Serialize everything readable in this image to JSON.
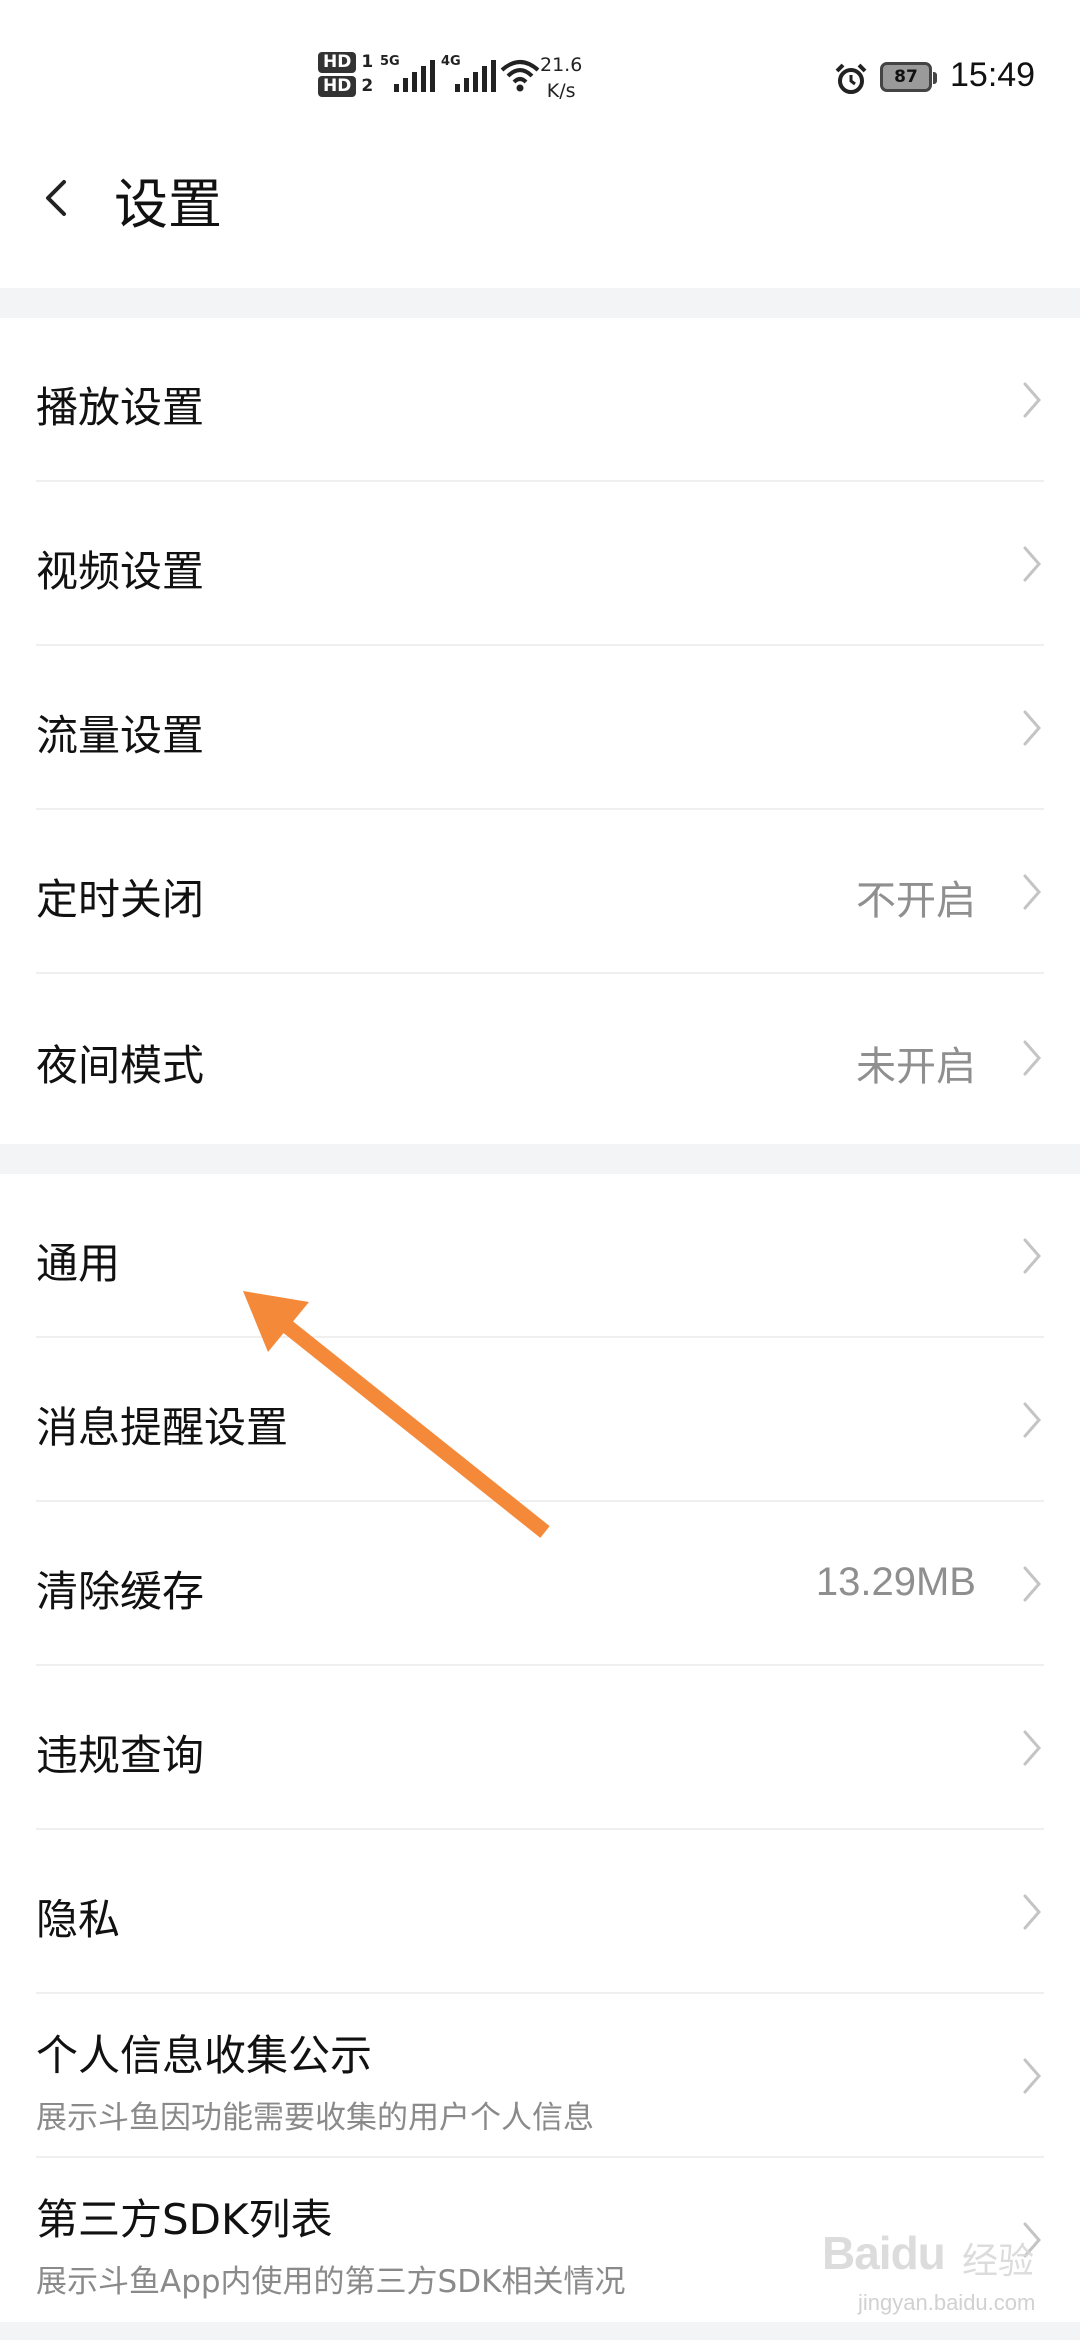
{
  "status_bar": {
    "hd1": "HD",
    "hd1_sim": "1",
    "hd2": "HD",
    "hd2_sim": "2",
    "net1": "5G",
    "net2": "4G",
    "speed_value": "21.6",
    "speed_unit": "K/s",
    "battery": "87",
    "time": "15:49",
    "icons": [
      "signal-icon",
      "wifi-icon",
      "alarm-icon",
      "battery-icon"
    ]
  },
  "header": {
    "title": "设置",
    "back_icon": "chevron-left-icon"
  },
  "settings": {
    "group1": [
      {
        "label": "播放设置",
        "value": ""
      },
      {
        "label": "视频设置",
        "value": ""
      },
      {
        "label": "流量设置",
        "value": ""
      },
      {
        "label": "定时关闭",
        "value": "不开启"
      },
      {
        "label": "夜间模式",
        "value": "未开启"
      }
    ],
    "group2": [
      {
        "label": "通用",
        "value": ""
      },
      {
        "label": "消息提醒设置",
        "value": ""
      },
      {
        "label": "清除缓存",
        "value": "13.29MB"
      },
      {
        "label": "违规查询",
        "value": ""
      },
      {
        "label": "隐私",
        "value": ""
      },
      {
        "label": "个人信息收集公示",
        "subtitle": "展示斗鱼因功能需要收集的用户个人信息",
        "value": ""
      },
      {
        "label": "第三方SDK列表",
        "subtitle": "展示斗鱼App内使用的第三方SDK相关情况",
        "value": ""
      }
    ]
  },
  "annotation": {
    "color": "#f5893a",
    "points_to": "通用"
  },
  "watermark": {
    "brand": "Baidu",
    "cn": "经验",
    "url": "jingyan.baidu.com"
  },
  "colors": {
    "gap": "#f2f4f5",
    "value_text": "#8f8f8f",
    "chevron": "#c4c4c4"
  }
}
